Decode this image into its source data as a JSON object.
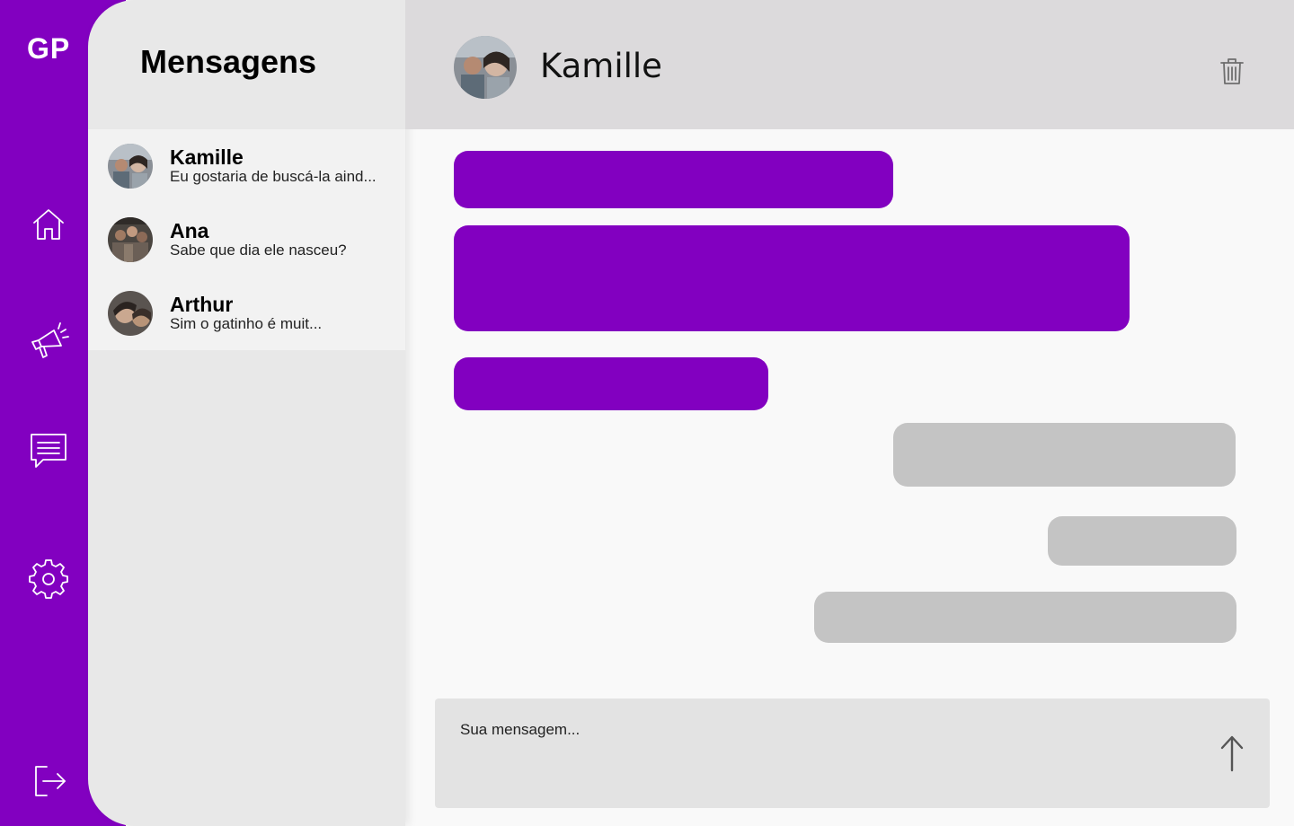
{
  "app": {
    "brand": "GP"
  },
  "nav": {
    "items": [
      {
        "name": "home",
        "icon": "home-icon"
      },
      {
        "name": "announcements",
        "icon": "megaphone-icon"
      },
      {
        "name": "messages",
        "icon": "chat-icon"
      },
      {
        "name": "settings",
        "icon": "gear-icon"
      },
      {
        "name": "logout",
        "icon": "logout-icon"
      }
    ]
  },
  "panel": {
    "title": "Mensagens",
    "conversations": [
      {
        "name": "Kamille",
        "preview": "Eu gostaria de buscá-la aind..."
      },
      {
        "name": "Ana",
        "preview": "Sabe que dia ele nasceu?"
      },
      {
        "name": "Arthur",
        "preview": "Sim o gatinho é muit..."
      }
    ]
  },
  "chat": {
    "contact_name": "Kamille",
    "composer_placeholder": "Sua mensagem..."
  },
  "colors": {
    "accent": "#8200c0",
    "received_bubble": "#c4c4c4",
    "header_bg": "#dcdadc"
  }
}
